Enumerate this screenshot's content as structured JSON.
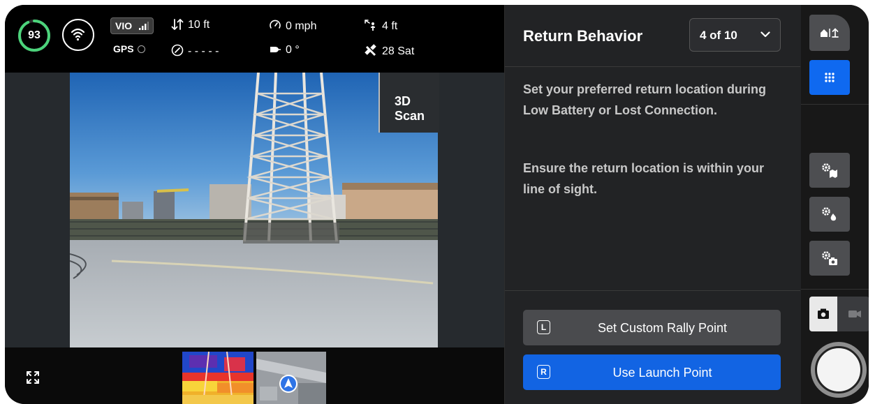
{
  "status": {
    "battery_percent": "93",
    "battery_level": 0.93,
    "vio_label": "VIO",
    "gps_label": "GPS",
    "altitude": "10 ft",
    "speed": "0 mph",
    "distance": "4 ft",
    "heading_readout": "- - - - -",
    "gimbal_angle": "0 °",
    "satellites": "28 Sat"
  },
  "camera": {
    "mode_tag": "3D Scan"
  },
  "panel": {
    "title": "Return Behavior",
    "step_selector": "4 of 10",
    "description_1": "Set your preferred return location during Low Battery or Lost Connection.",
    "description_2": "Ensure the return location is within your line of sight.",
    "custom_rally": {
      "key": "L",
      "label": "Set Custom Rally Point"
    },
    "launch_point": {
      "key": "R",
      "label": "Use Launch Point"
    }
  },
  "colors": {
    "accent_blue": "#1264e3",
    "battery_green": "#4cd37b",
    "panel_bg": "#222325"
  },
  "icons": [
    "wifi-icon",
    "signal-bars-icon",
    "altitude-arrows-icon",
    "speedometer-icon",
    "distance-icon",
    "compass-icon",
    "gimbal-icon",
    "satellite-icon",
    "expand-icon",
    "chevron-down-icon",
    "home-return-icon",
    "grid-icon",
    "map-settings-icon",
    "flame-settings-icon",
    "camera-settings-icon",
    "photo-icon",
    "video-icon"
  ]
}
